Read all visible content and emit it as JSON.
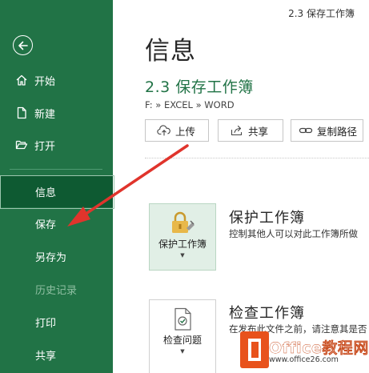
{
  "window": {
    "title": "2.3 保存工作簿"
  },
  "sidebar": {
    "items": [
      {
        "label": "开始",
        "icon": "home-icon"
      },
      {
        "label": "新建",
        "icon": "new-document-icon"
      },
      {
        "label": "打开",
        "icon": "folder-open-icon"
      },
      {
        "label": "信息"
      },
      {
        "label": "保存"
      },
      {
        "label": "另存为"
      },
      {
        "label": "历史记录"
      },
      {
        "label": "打印"
      },
      {
        "label": "共享"
      }
    ]
  },
  "main": {
    "page_title": "信息",
    "doc_title": "2.3 保存工作簿",
    "doc_path": "F: » EXCEL » WORD",
    "actions": [
      {
        "label": "上传",
        "icon": "cloud-upload-icon"
      },
      {
        "label": "共享",
        "icon": "share-icon"
      },
      {
        "label": "复制路径",
        "icon": "link-icon"
      }
    ],
    "protect": {
      "button_label": "保护工作簿",
      "heading": "保护工作簿",
      "desc": "控制其他人可以对此工作簿所做"
    },
    "inspect": {
      "button_label": "检查问题",
      "heading": "检查工作簿",
      "desc": "在发布此文件之前，请注意其是否"
    }
  },
  "watermark": {
    "line1": "Office教程网",
    "line2": "www.office26.com"
  },
  "colors": {
    "accent": "#217346",
    "arrow": "#e0342c",
    "watermark": "#e8521c"
  }
}
